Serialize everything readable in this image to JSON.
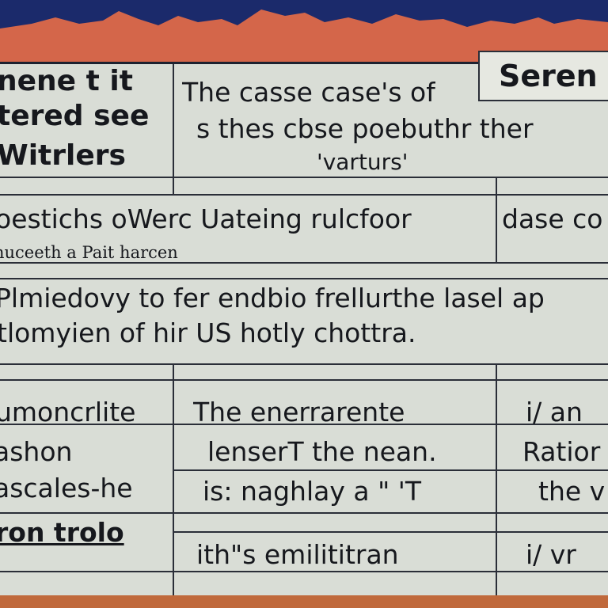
{
  "board": {
    "header": {
      "left_lines": [
        "nene t it",
        "tered see",
        "Witrlers"
      ],
      "center_lines": [
        "The casse case's of",
        "s thes cbse poebuthr ther",
        "'varturs'"
      ],
      "tag": "Seren"
    },
    "row2": {
      "main": "oestichs oWerc Uateing rulcfoor",
      "sub": "nuceeth a Pait harcen",
      "right": "dase co"
    },
    "row3": {
      "line1": "Plmiedovy to fer endbio frellurthe lasel ap",
      "line2": "tlomyien of hir US hotly chottra."
    },
    "lower": {
      "left_lines": [
        "umoncrlite",
        "ashon",
        "ascales-he",
        "ron trolo"
      ],
      "center_lines": [
        "The enerrarente",
        "lenserT the nean.",
        "is: naghlay a \" 'T",
        "ith\"s emilititran"
      ],
      "right_lines": [
        "i/ an",
        "Ratior",
        "the v",
        "i/ vr"
      ]
    }
  },
  "colors": {
    "sky": "#1b2a6b",
    "mountains": "#d4664a",
    "board": "#d9ddd6",
    "ink": "#16181d",
    "ground": "#c0693c"
  }
}
